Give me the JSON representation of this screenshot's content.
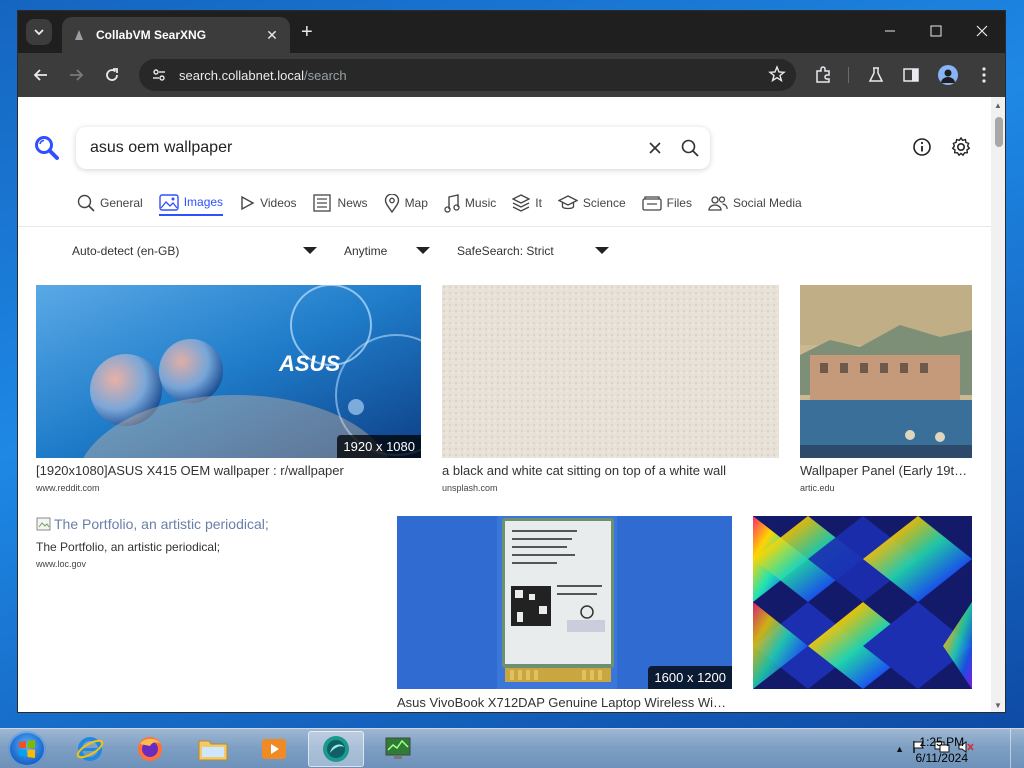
{
  "browser": {
    "tab_title": "CollabVM SearXNG",
    "url_host": "search.collabnet.local",
    "url_path": "/search"
  },
  "search": {
    "query": "asus oem wallpaper"
  },
  "categories": [
    {
      "label": "General",
      "icon": "search-icon"
    },
    {
      "label": "Images",
      "icon": "image-icon"
    },
    {
      "label": "Videos",
      "icon": "play-icon"
    },
    {
      "label": "News",
      "icon": "newspaper-icon"
    },
    {
      "label": "Map",
      "icon": "map-pin-icon"
    },
    {
      "label": "Music",
      "icon": "music-note-icon"
    },
    {
      "label": "It",
      "icon": "layers-icon"
    },
    {
      "label": "Science",
      "icon": "graduation-cap-icon"
    },
    {
      "label": "Files",
      "icon": "files-icon"
    },
    {
      "label": "Social Media",
      "icon": "people-icon"
    }
  ],
  "active_category": "Images",
  "filters": {
    "language": "Auto-detect (en-GB)",
    "time": "Anytime",
    "safesearch": "SafeSearch: Strict"
  },
  "results": [
    {
      "title": "[1920x1080]ASUS X415 OEM wallpaper : r/wallpaper",
      "source": "www.reddit.com",
      "resolution": "1920 x 1080"
    },
    {
      "title": "a black and white cat sitting on top of a white wall",
      "source": "unsplash.com"
    },
    {
      "title": "Wallpaper Panel (Early 19t…",
      "source": "artic.edu"
    },
    {
      "title": "The Portfolio, an artistic periodical;",
      "alt": "The Portfolio, an artistic periodical;",
      "source": "www.loc.gov"
    },
    {
      "title": "Asus VivoBook X712DAP Genuine Laptop Wireless Wi…",
      "resolution": "1600 x 1200"
    },
    {
      "title": ""
    }
  ],
  "thumb_labels": {
    "asus_logo": "ASUS"
  },
  "taskbar": {
    "time": "1:25 PM",
    "date": "6/11/2024"
  },
  "colors": {
    "accent": "#3050ff",
    "chrome_dark": "#1f1f1f",
    "toolbar": "#3c3c3c"
  }
}
